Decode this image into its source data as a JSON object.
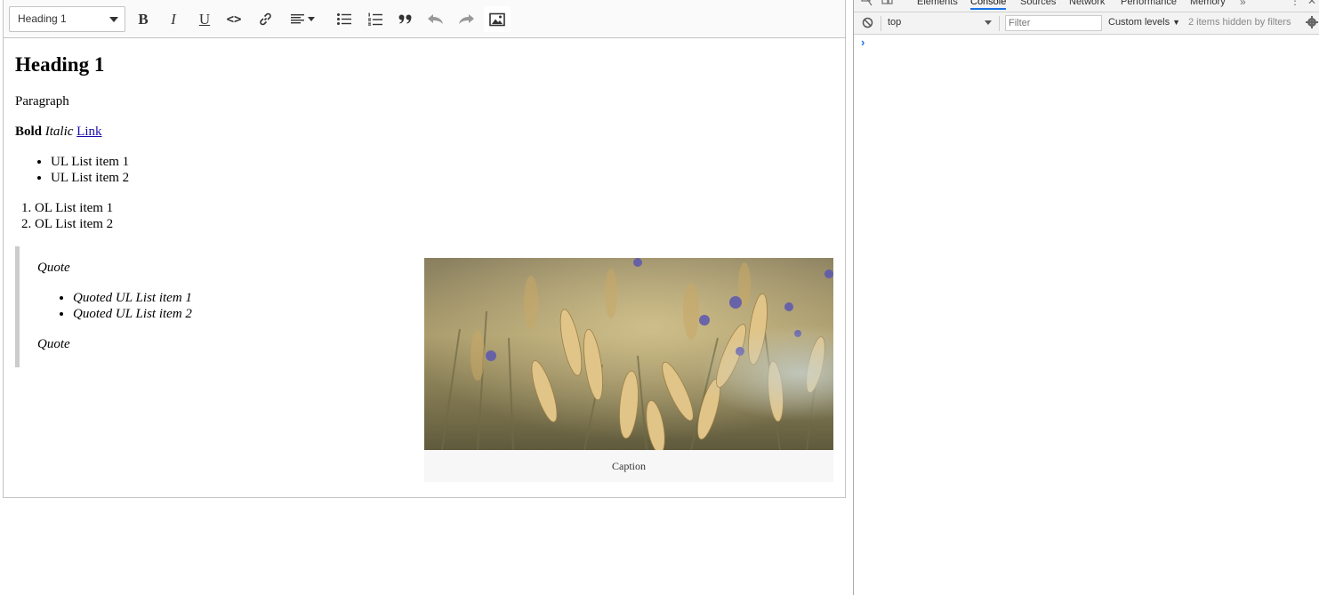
{
  "editor": {
    "toolbar": {
      "heading_select": "Heading 1",
      "buttons": {
        "bold": "B",
        "italic": "I",
        "underline": "U",
        "code": "<>"
      }
    },
    "content": {
      "heading": "Heading 1",
      "paragraph": "Paragraph",
      "bold": "Bold",
      "italic": "Italic",
      "link": "Link",
      "ul": [
        "UL List item 1",
        "UL List item 2"
      ],
      "ol": [
        "OL List item 1",
        "OL List item 2"
      ],
      "quote": {
        "first": "Quote",
        "list": [
          "Quoted UL List item 1",
          "Quoted UL List item 2"
        ],
        "last": "Quote"
      },
      "figure_caption": "Caption"
    }
  },
  "devtools": {
    "tabs": [
      "Elements",
      "Console",
      "Sources",
      "Network",
      "Performance",
      "Memory"
    ],
    "active_tab": "Console",
    "context": "top",
    "filter_placeholder": "Filter",
    "levels": "Custom levels",
    "hidden_info": "2 items hidden by filters",
    "accent_color": "#1a73e8"
  }
}
